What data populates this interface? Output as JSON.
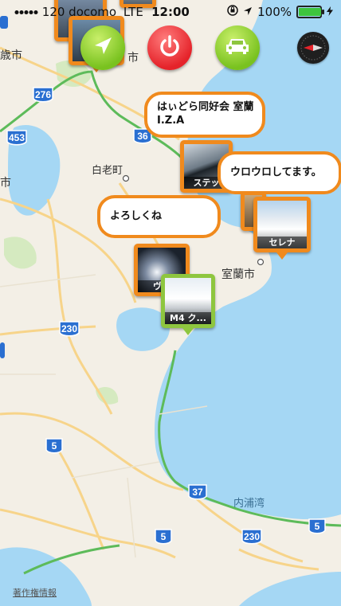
{
  "status_bar": {
    "carrier": "120 docomo",
    "network": "LTE",
    "time": "12:00",
    "battery": "100%",
    "battery_level": 1.0
  },
  "toolbar": {
    "navigate_icon": "navigation-arrow-icon",
    "power_icon": "power-icon",
    "car_icon": "car-icon",
    "compass_icon": "compass-icon"
  },
  "map": {
    "labels": {
      "city_1": "歳市",
      "city_2": "白老町",
      "city_3": "室蘭市",
      "city_4": "市",
      "bay": "内浦湾",
      "city_5": "市"
    },
    "route_shields": [
      "276",
      "453",
      "36",
      "230",
      "5",
      "37",
      "230",
      "5",
      "5"
    ]
  },
  "bubbles": {
    "b1": "はぃどら同好会 室蘭\nI.Z.A",
    "b2": "ウロウロしてます。",
    "b3": "よろしくね"
  },
  "pins": {
    "p1": "ステッ",
    "p2": "セレナ",
    "p3": "ヴェ",
    "p4": "M4 ク...",
    "p5": "",
    "p6": ""
  },
  "legal": "著作権情報",
  "colors": {
    "water": "#a5d7f4",
    "land": "#f3efe6",
    "road": "#f7d48a",
    "highway": "#5dbb5a",
    "pin_border": "#f08a1d",
    "pin_selected": "#8ec63f"
  }
}
